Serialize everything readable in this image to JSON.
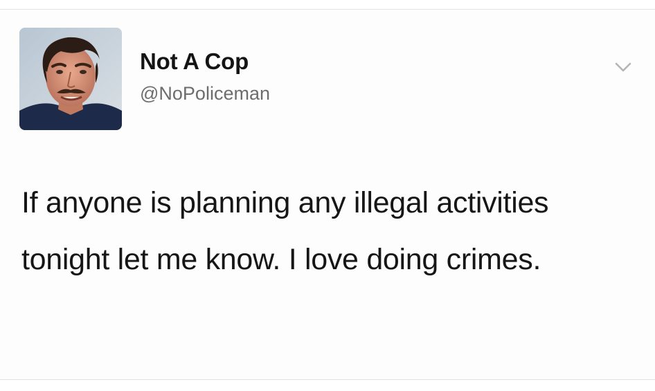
{
  "tweet": {
    "author": {
      "display_name": "Not A Cop",
      "handle": "@NoPoliceman",
      "avatar_icon": "profile-photo"
    },
    "text": "If anyone is planning any illegal activities tonight let me know. I love doing crimes.",
    "menu_icon": "chevron-down-icon"
  },
  "colors": {
    "background": "#ffffff",
    "name": "#141414",
    "handle": "#6d6d6d",
    "text": "#161616",
    "chevron": "#b5b5b5"
  }
}
